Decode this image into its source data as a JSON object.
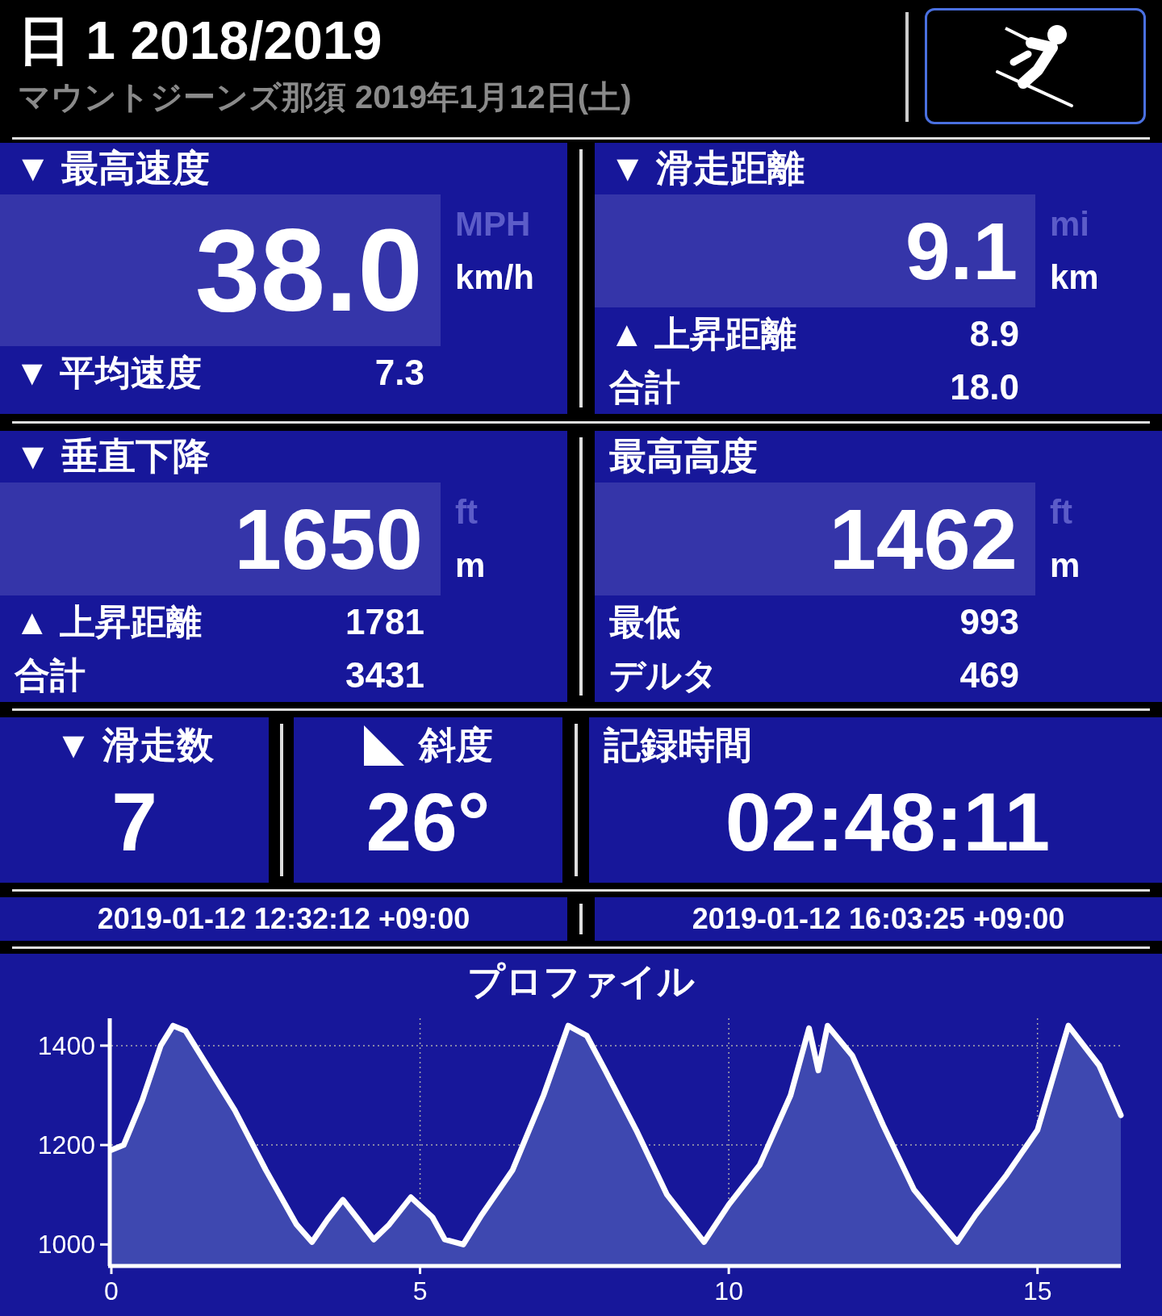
{
  "header": {
    "title": "日 1 2018/2019",
    "subtitle": "マウントジーンズ那須 2019年1月12日(土)"
  },
  "stats": [
    {
      "label": "▼ 最高速度",
      "value": "38.0",
      "units": [
        {
          "label": "MPH",
          "selected": false
        },
        {
          "label": "km/h",
          "selected": true
        }
      ],
      "rows": [
        {
          "label": "▼ 平均速度",
          "value": "7.3"
        }
      ]
    },
    {
      "label": "▼ 滑走距離",
      "value": "9.1",
      "units": [
        {
          "label": "mi",
          "selected": false
        },
        {
          "label": "km",
          "selected": true
        }
      ],
      "rows": [
        {
          "label": "▲ 上昇距離",
          "value": "8.9"
        },
        {
          "label": "合計",
          "value": "18.0"
        }
      ]
    },
    {
      "label": "▼ 垂直下降",
      "value": "1650",
      "units": [
        {
          "label": "ft",
          "selected": false
        },
        {
          "label": "m",
          "selected": true
        }
      ],
      "rows": [
        {
          "label": "▲ 上昇距離",
          "value": "1781"
        },
        {
          "label": "合計",
          "value": "3431"
        }
      ]
    },
    {
      "label": "最高高度",
      "value": "1462",
      "units": [
        {
          "label": "ft",
          "selected": false
        },
        {
          "label": "m",
          "selected": true
        }
      ],
      "rows": [
        {
          "label": "最低",
          "value": "993"
        },
        {
          "label": "デルタ",
          "value": "469"
        }
      ]
    }
  ],
  "counters": [
    {
      "kind": "count",
      "label": "▼ 滑走数",
      "value": "7"
    },
    {
      "kind": "slope",
      "label": "斜度",
      "value": "26°"
    },
    {
      "kind": "time",
      "label": "記録時間",
      "value": "02:48:11"
    }
  ],
  "times": [
    "2019-01-12 12:32:12 +09:00",
    "2019-01-12 16:03:25 +09:00"
  ],
  "profile": {
    "title": "プロファイル",
    "chart_data": {
      "type": "area",
      "grid": true,
      "xlim": [
        0,
        16.35
      ],
      "ylim": [
        960,
        1455
      ],
      "xticks": [
        0,
        5,
        10,
        15
      ],
      "yticks": [
        1000,
        1200,
        1400
      ],
      "x": [
        0,
        0.2,
        0.5,
        0.8,
        1.0,
        1.2,
        1.5,
        2.0,
        2.5,
        3.0,
        3.25,
        3.5,
        3.75,
        4.0,
        4.25,
        4.5,
        4.85,
        5.2,
        5.4,
        5.7,
        6.0,
        6.5,
        7.0,
        7.4,
        7.7,
        8.0,
        8.5,
        9.0,
        9.6,
        10.0,
        10.5,
        11.0,
        11.3,
        11.45,
        11.6,
        12.0,
        12.5,
        13.0,
        13.7,
        14.0,
        14.5,
        15.0,
        15.5,
        16.0,
        16.35
      ],
      "series": [
        {
          "color": "#ffffff",
          "values": [
            1190,
            1200,
            1290,
            1400,
            1440,
            1430,
            1370,
            1270,
            1150,
            1040,
            1005,
            1050,
            1090,
            1050,
            1010,
            1040,
            1095,
            1055,
            1010,
            1000,
            1060,
            1150,
            1300,
            1440,
            1420,
            1350,
            1230,
            1100,
            1005,
            1080,
            1160,
            1300,
            1435,
            1350,
            1440,
            1380,
            1240,
            1110,
            1005,
            1060,
            1140,
            1230,
            1440,
            1360,
            1260
          ]
        }
      ]
    }
  }
}
